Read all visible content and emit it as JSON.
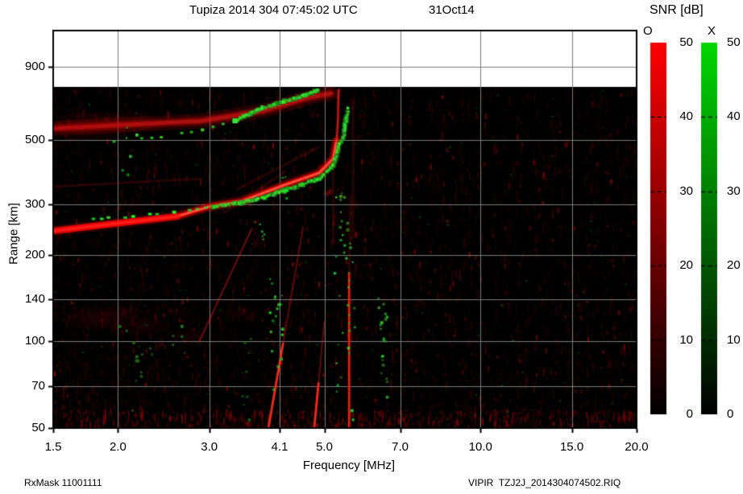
{
  "header": {
    "title": "Tupiza 2014 304 07:45:02 UTC",
    "date": "31Oct14"
  },
  "colorbar": {
    "title": "SNR [dB]",
    "o_label": "O",
    "x_label": "X",
    "tick_labels": [
      "0",
      "10",
      "20",
      "30",
      "40",
      "50"
    ],
    "tick_values": [
      0,
      10,
      20,
      30,
      40,
      50
    ],
    "o_top_color": "#ff0000",
    "x_top_color": "#00d700",
    "bottom_color": "#000000"
  },
  "axes": {
    "x": {
      "label": "Frequency [MHz]",
      "tick_labels": [
        "1.5",
        "2.0",
        "3.0",
        "4.1",
        "5.0",
        "7.0",
        "10.0",
        "15.0",
        "20.0"
      ],
      "tick_values": [
        1.5,
        2.0,
        3.0,
        4.1,
        5.0,
        7.0,
        10.0,
        15.0,
        20.0
      ],
      "scale": "log",
      "min": 1.5,
      "max": 20
    },
    "y": {
      "label": "Range [km]",
      "tick_labels": [
        "50",
        "70",
        "100",
        "140",
        "200",
        "300",
        "500",
        "900"
      ],
      "tick_values": [
        50,
        70,
        100,
        140,
        200,
        300,
        500,
        900
      ],
      "scale": "log",
      "min": 50,
      "max": 1200
    }
  },
  "footer": {
    "left": "RxMask 11001111",
    "right": "VIPIR  TZJ2J_2014304074502.RIQ"
  },
  "chart_data": {
    "type": "heatmap",
    "title": "Tupiza 2014 304 07:45:02 UTC  31Oct14",
    "xlabel": "Frequency [MHz]",
    "ylabel": "Range [km]",
    "x_ticks": [
      1.5,
      2.0,
      3.0,
      4.1,
      5.0,
      7.0,
      10.0,
      15.0,
      20.0
    ],
    "y_ticks": [
      50,
      70,
      100,
      140,
      200,
      300,
      500,
      900
    ],
    "x_scale": "log",
    "y_scale": "log",
    "snr_scale_dB": [
      0,
      50
    ],
    "colorbars": [
      {
        "name": "O",
        "color": "red",
        "range_dB": [
          0,
          50
        ]
      },
      {
        "name": "X",
        "color": "green",
        "range_dB": [
          0,
          50
        ]
      }
    ],
    "data_region_top_km": 760,
    "foF2_MHz": 5.3,
    "fxF2_MHz": 5.55,
    "traces": {
      "o_main": [
        [
          1.5,
          242
        ],
        [
          1.95,
          256
        ],
        [
          2.6,
          272
        ],
        [
          3.0,
          294
        ],
        [
          3.46,
          307
        ],
        [
          4.18,
          349
        ],
        [
          4.89,
          385
        ],
        [
          5.2,
          432
        ],
        [
          5.28,
          498
        ]
      ],
      "o_main_tip": [
        [
          5.28,
          498
        ],
        [
          5.31,
          584
        ],
        [
          5.32,
          700
        ],
        [
          5.33,
          748
        ]
      ],
      "x_main_sparse": [
        [
          1.79,
          266
        ],
        [
          2.14,
          272
        ],
        [
          2.56,
          281
        ],
        [
          3.06,
          295
        ]
      ],
      "x_main": [
        [
          3.06,
          295
        ],
        [
          3.46,
          303
        ],
        [
          3.83,
          317
        ],
        [
          4.18,
          334
        ],
        [
          4.89,
          368
        ],
        [
          5.2,
          410
        ],
        [
          5.33,
          473
        ],
        [
          5.45,
          524
        ],
        [
          5.5,
          584
        ],
        [
          5.55,
          643
        ]
      ],
      "o_second_hop": [
        [
          1.5,
          549
        ],
        [
          1.96,
          563
        ],
        [
          2.9,
          584
        ],
        [
          3.8,
          632
        ],
        [
          4.18,
          665
        ],
        [
          4.6,
          700
        ],
        [
          5.14,
          727
        ]
      ],
      "x_second_hop_sparse": [
        [
          1.96,
          495
        ],
        [
          2.42,
          514
        ],
        [
          2.9,
          541
        ],
        [
          3.36,
          584
        ]
      ],
      "x_second_hop": [
        [
          3.36,
          584
        ],
        [
          3.8,
          648
        ],
        [
          4.18,
          682
        ],
        [
          4.6,
          718
        ],
        [
          4.86,
          742
        ]
      ],
      "oblique_red": [
        {
          "kind": "faint",
          "pts": [
            [
              1.5,
              345
            ],
            [
              2.9,
              368
            ]
          ]
        },
        {
          "kind": "medium",
          "pts": [
            [
              2.87,
              100
            ],
            [
              3.62,
              246
            ]
          ]
        },
        {
          "kind": "bright_bottom",
          "pts": [
            [
              3.9,
              50
            ],
            [
              4.55,
              249
            ]
          ]
        },
        {
          "kind": "bright_bottom",
          "pts": [
            [
              4.78,
              50
            ],
            [
              5.0,
              117
            ]
          ]
        },
        {
          "kind": "bright",
          "pts": [
            [
              5.58,
              50
            ],
            [
              5.58,
              172
            ]
          ]
        },
        {
          "kind": "faint",
          "pts": [
            [
              5.58,
              172
            ],
            [
              5.62,
              320
            ]
          ]
        },
        {
          "kind": "faint",
          "pts": [
            [
              5.2,
              220
            ],
            [
              5.2,
              420
            ]
          ]
        },
        {
          "kind": "faint",
          "pts": [
            [
              5.68,
              230
            ],
            [
              5.68,
              690
            ]
          ]
        },
        {
          "kind": "faint",
          "pts": [
            [
              3.4,
              338
            ],
            [
              4.87,
              473
            ]
          ]
        },
        {
          "kind": "faint",
          "pts": [
            [
              3.2,
              280
            ],
            [
              4.2,
              390
            ]
          ]
        }
      ],
      "green_clusters": [
        {
          "f": [
            3.68,
            3.82
          ],
          "r": [
            225,
            260
          ],
          "n": 6,
          "bright": true
        },
        {
          "f": [
            3.9,
            4.15
          ],
          "r": [
            62,
            170
          ],
          "n": 18,
          "bright": true
        },
        {
          "f": [
            3.45,
            3.6
          ],
          "r": [
            50,
            105
          ],
          "n": 8,
          "bright": false
        },
        {
          "f": [
            5.2,
            5.7
          ],
          "r": [
            50,
            330
          ],
          "n": 40,
          "bright": true
        },
        {
          "f": [
            6.3,
            6.6
          ],
          "r": [
            55,
            145
          ],
          "n": 20,
          "bright": true
        },
        {
          "f": [
            1.95,
            2.75
          ],
          "r": [
            88,
            115
          ],
          "n": 12,
          "bright": false
        },
        {
          "f": [
            2.1,
            2.22
          ],
          "r": [
            56,
            92
          ],
          "n": 8,
          "bright": false
        },
        {
          "f": [
            2.02,
            2.18
          ],
          "r": [
            330,
            560
          ],
          "n": 6,
          "bright": true
        },
        {
          "f": [
            4.12,
            4.25
          ],
          "r": [
            310,
            390
          ],
          "n": 6,
          "bright": true
        }
      ]
    }
  }
}
